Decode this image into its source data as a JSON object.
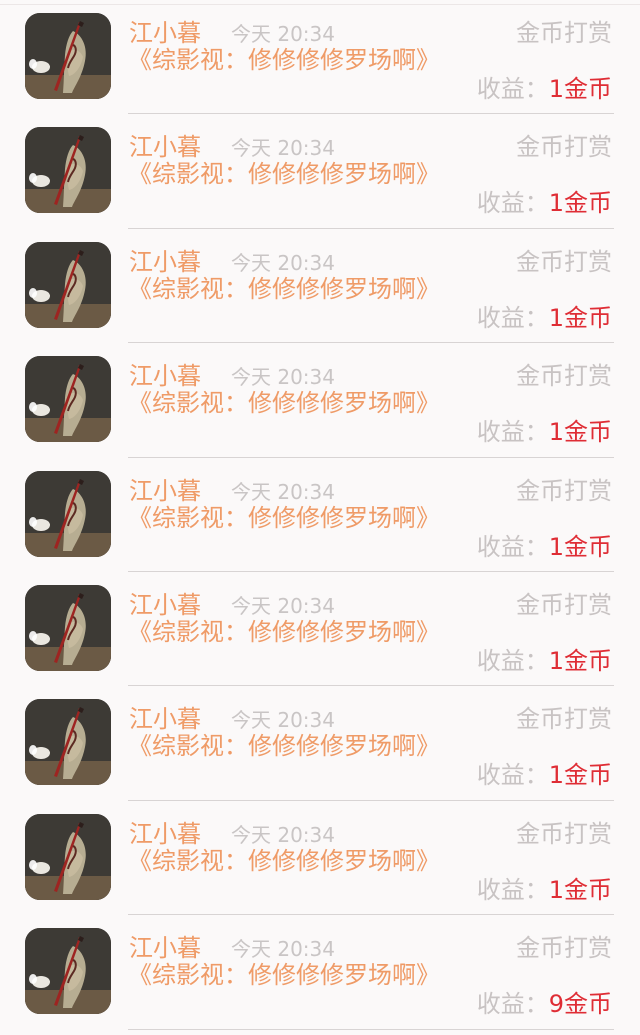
{
  "list": {
    "items": [
      {
        "name": "江小暮",
        "time": "今天 20:34",
        "reward": "金币打赏",
        "book": "《综影视：修修修修罗场啊》",
        "income_label": "收益：",
        "income_value": "1金币"
      },
      {
        "name": "江小暮",
        "time": "今天 20:34",
        "reward": "金币打赏",
        "book": "《综影视：修修修修罗场啊》",
        "income_label": "收益：",
        "income_value": "1金币"
      },
      {
        "name": "江小暮",
        "time": "今天 20:34",
        "reward": "金币打赏",
        "book": "《综影视：修修修修罗场啊》",
        "income_label": "收益：",
        "income_value": "1金币"
      },
      {
        "name": "江小暮",
        "time": "今天 20:34",
        "reward": "金币打赏",
        "book": "《综影视：修修修修罗场啊》",
        "income_label": "收益：",
        "income_value": "1金币"
      },
      {
        "name": "江小暮",
        "time": "今天 20:34",
        "reward": "金币打赏",
        "book": "《综影视：修修修修罗场啊》",
        "income_label": "收益：",
        "income_value": "1金币"
      },
      {
        "name": "江小暮",
        "time": "今天 20:34",
        "reward": "金币打赏",
        "book": "《综影视：修修修修罗场啊》",
        "income_label": "收益：",
        "income_value": "1金币"
      },
      {
        "name": "江小暮",
        "time": "今天 20:34",
        "reward": "金币打赏",
        "book": "《综影视：修修修修罗场啊》",
        "income_label": "收益：",
        "income_value": "1金币"
      },
      {
        "name": "江小暮",
        "time": "今天 20:34",
        "reward": "金币打赏",
        "book": "《综影视：修修修修罗场啊》",
        "income_label": "收益：",
        "income_value": "1金币"
      },
      {
        "name": "江小暮",
        "time": "今天 20:34",
        "reward": "金币打赏",
        "book": "《综影视：修修修修罗场啊》",
        "income_label": "收益：",
        "income_value": "9金币"
      }
    ]
  }
}
